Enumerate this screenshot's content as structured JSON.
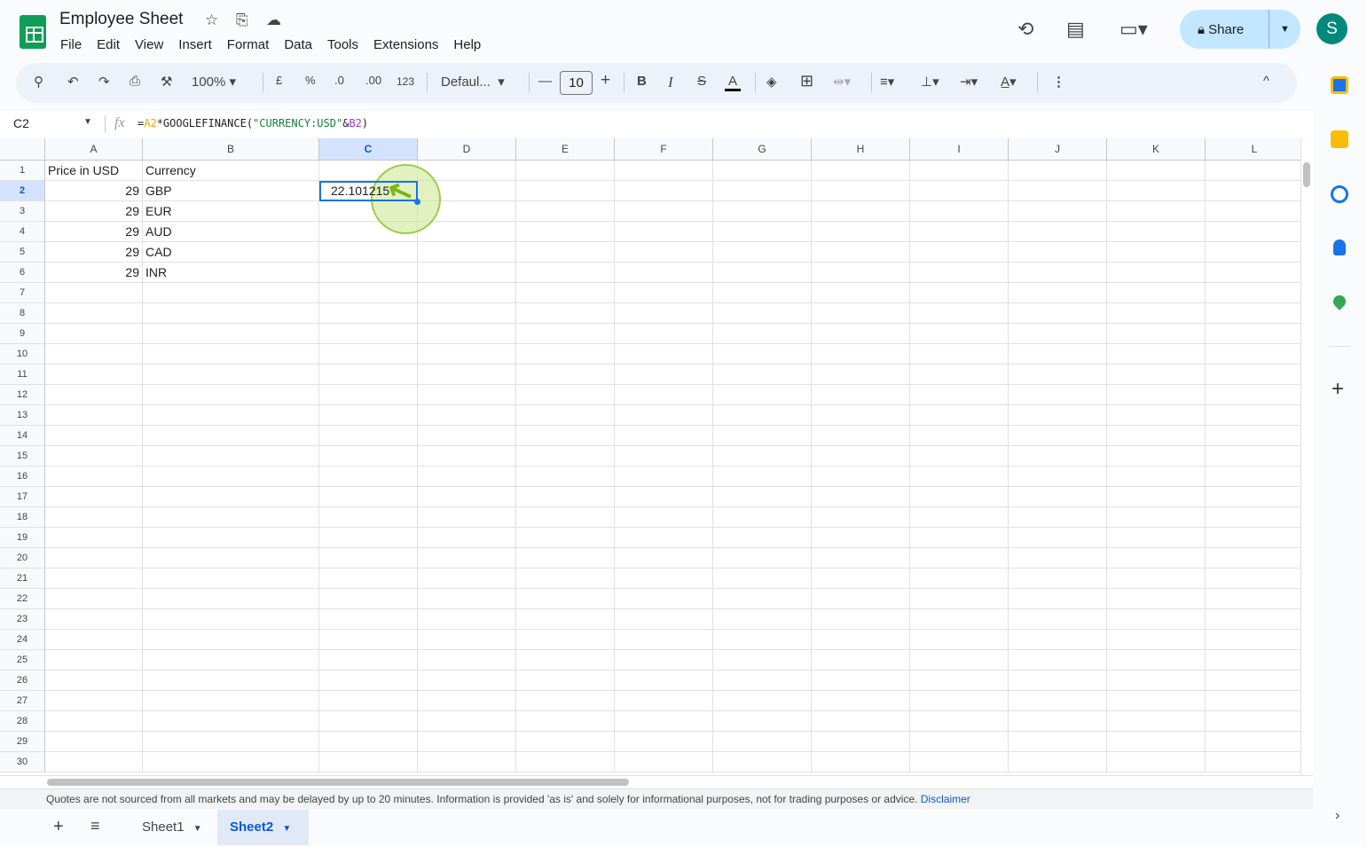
{
  "app": {
    "title": "Employee Sheet",
    "menu": [
      "File",
      "Edit",
      "View",
      "Insert",
      "Format",
      "Data",
      "Tools",
      "Extensions",
      "Help"
    ],
    "share_label": "Share",
    "avatar_letter": "S"
  },
  "toolbar": {
    "zoom": "100%",
    "currency": "£",
    "percent": "%",
    "dec_decrease": ".0",
    "dec_increase": ".00",
    "number_format": "123",
    "font": "Defaul...",
    "font_size": "10"
  },
  "formula_bar": {
    "name_box": "C2",
    "fx": "fx",
    "formula_parts": [
      {
        "t": "=",
        "c": "#1f1f1f"
      },
      {
        "t": "A2",
        "c": "#f4a20b"
      },
      {
        "t": "*GOOGLEFINANCE(",
        "c": "#1f1f1f"
      },
      {
        "t": "\"CURRENCY:USD\"",
        "c": "#188038"
      },
      {
        "t": "&",
        "c": "#1f1f1f"
      },
      {
        "t": "B2",
        "c": "#9334e6"
      },
      {
        "t": ")",
        "c": "#1f1f1f"
      }
    ]
  },
  "sheet": {
    "columns": [
      "A",
      "B",
      "C",
      "D",
      "E",
      "F",
      "G",
      "H",
      "I",
      "J",
      "K",
      "L"
    ],
    "row_count": 30,
    "selected_cell": "C2",
    "cells": [
      [
        "Price in USD",
        "Currency",
        ""
      ],
      [
        "29",
        "GBP",
        "22.101215"
      ],
      [
        "29",
        "EUR",
        ""
      ],
      [
        "29",
        "AUD",
        ""
      ],
      [
        "29",
        "CAD",
        ""
      ],
      [
        "29",
        "INR",
        ""
      ]
    ]
  },
  "notice": {
    "text": "Quotes are not sourced from all markets and may be delayed by up to 20 minutes. Information is provided 'as is' and solely for informational purposes, not for trading purposes or advice. ",
    "link": "Disclaimer"
  },
  "sheet_tabs": [
    {
      "label": "Sheet1",
      "active": false
    },
    {
      "label": "Sheet2",
      "active": true
    }
  ],
  "colors": {
    "accent": "#0b57d0",
    "selection": "#1a73e8",
    "highlight": "#8bc34a"
  }
}
